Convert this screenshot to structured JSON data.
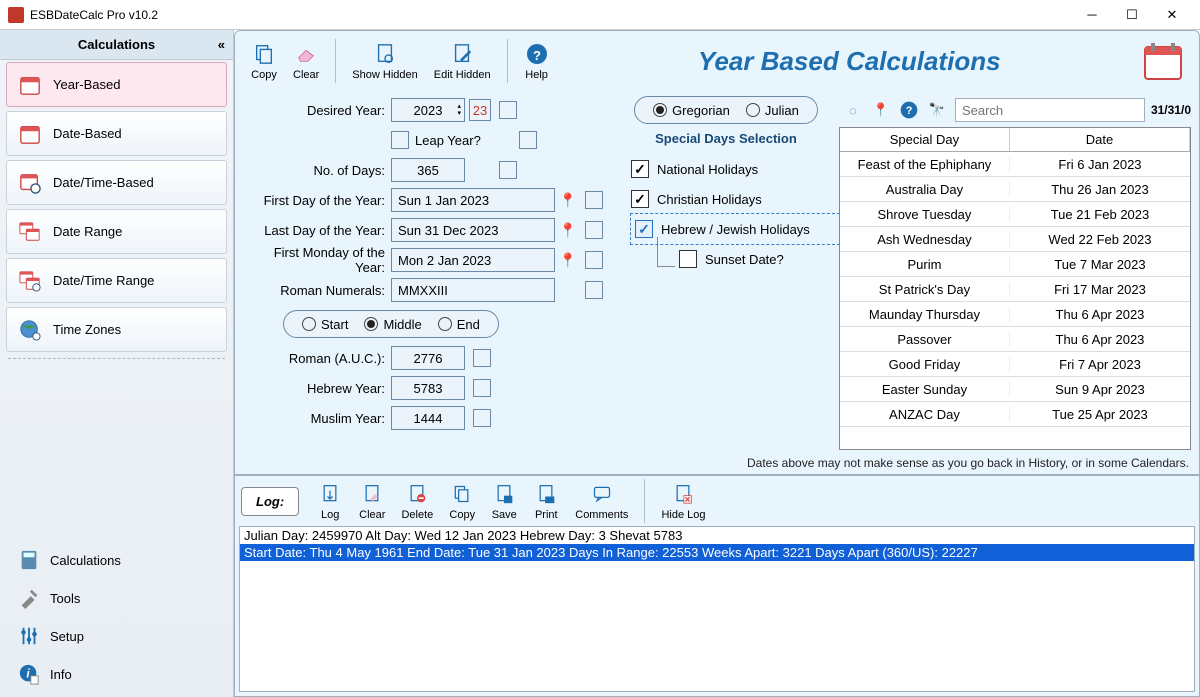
{
  "titlebar": {
    "title": "ESBDateCalc Pro v10.2"
  },
  "sidebar": {
    "header": "Calculations",
    "items": [
      {
        "label": "Year-Based"
      },
      {
        "label": "Date-Based"
      },
      {
        "label": "Date/Time-Based"
      },
      {
        "label": "Date Range"
      },
      {
        "label": "Date/Time Range"
      },
      {
        "label": "Time Zones"
      }
    ],
    "bottom": [
      {
        "label": "Calculations"
      },
      {
        "label": "Tools"
      },
      {
        "label": "Setup"
      },
      {
        "label": "Info"
      }
    ]
  },
  "toolbar": {
    "copy": "Copy",
    "clear": "Clear",
    "show_hidden": "Show Hidden",
    "edit_hidden": "Edit Hidden",
    "help": "Help"
  },
  "page_title": "Year Based Calculations",
  "form": {
    "desired_year_lbl": "Desired Year:",
    "desired_year": "2023",
    "cal_btn": "23",
    "leap_lbl": "Leap Year?",
    "nodays_lbl": "No. of Days:",
    "nodays": "365",
    "first_lbl": "First Day of the Year:",
    "first": "Sun 1 Jan 2023",
    "last_lbl": "Last Day of the Year:",
    "last": "Sun 31 Dec 2023",
    "mon_lbl": "First Monday of the Year:",
    "mon": "Mon 2 Jan 2023",
    "roman_lbl": "Roman Numerals:",
    "roman": "MMXXIII",
    "start": "Start",
    "middle": "Middle",
    "end": "End",
    "auc_lbl": "Roman (A.U.C.):",
    "auc": "2776",
    "heb_lbl": "Hebrew Year:",
    "heb": "5783",
    "mus_lbl": "Muslim Year:",
    "mus": "1444"
  },
  "caltype": {
    "gregorian": "Gregorian",
    "julian": "Julian"
  },
  "special": {
    "heading": "Special Days Selection",
    "national": "National Holidays",
    "christian": "Christian Holidays",
    "hebrew": "Hebrew / Jewish Holidays",
    "sunset": "Sunset Date?"
  },
  "search": {
    "placeholder": "Search",
    "counter": "31/31/0"
  },
  "table": {
    "h1": "Special Day",
    "h2": "Date",
    "rows": [
      {
        "d": "Feast of the Ephiphany",
        "t": "Fri 6 Jan 2023"
      },
      {
        "d": "Australia Day",
        "t": "Thu 26 Jan 2023"
      },
      {
        "d": "Shrove Tuesday",
        "t": "Tue 21 Feb 2023"
      },
      {
        "d": "Ash Wednesday",
        "t": "Wed 22 Feb 2023"
      },
      {
        "d": "Purim",
        "t": "Tue 7 Mar 2023"
      },
      {
        "d": "St Patrick's Day",
        "t": "Fri 17 Mar 2023"
      },
      {
        "d": "Maunday Thursday",
        "t": "Thu 6 Apr 2023"
      },
      {
        "d": "Passover",
        "t": "Thu 6 Apr 2023"
      },
      {
        "d": "Good Friday",
        "t": "Fri 7 Apr 2023"
      },
      {
        "d": "Easter Sunday",
        "t": "Sun 9 Apr 2023"
      },
      {
        "d": "ANZAC Day",
        "t": "Tue 25 Apr 2023"
      }
    ]
  },
  "note": "Dates above may not make sense as you go back in History, or in some Calendars.",
  "log": {
    "label": "Log:",
    "btns": {
      "log": "Log",
      "clear": "Clear",
      "delete": "Delete",
      "copy": "Copy",
      "save": "Save",
      "print": "Print",
      "comments": "Comments",
      "hide": "Hide Log"
    },
    "lines": [
      "Julian Day: 2459970 Alt Day: Wed 12 Jan 2023 Hebrew Day: 3 Shevat 5783",
      "Start Date: Thu 4 May 1961 End Date: Tue 31 Jan 2023 Days In Range: 22553 Weeks Apart: 3221 Days Apart (360/US): 22227"
    ]
  }
}
